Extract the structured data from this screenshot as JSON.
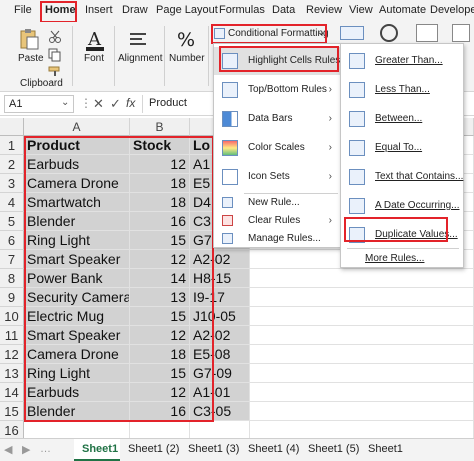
{
  "menu_tabs": [
    "File",
    "Home",
    "Insert",
    "Draw",
    "Page Layout",
    "Formulas",
    "Data",
    "Review",
    "View",
    "Automate",
    "Developer"
  ],
  "ribbon": {
    "paste_label": "Paste",
    "clipboard_label": "Clipboard",
    "font_label": "Font",
    "alignment_label": "Alignment",
    "number_label": "Number",
    "conditional_formatting_label": "Conditional Formatting"
  },
  "formula_bar": {
    "name_box": "A1",
    "fx": "fx",
    "content": "Product"
  },
  "columns": [
    "A",
    "B"
  ],
  "column_c_partial": "",
  "rows": [
    {
      "n": "1",
      "product": "Product",
      "stock": "Stock",
      "loc": "Lo"
    },
    {
      "n": "2",
      "product": "Earbuds",
      "stock": "12",
      "loc": "A1"
    },
    {
      "n": "3",
      "product": "Camera Drone",
      "stock": "18",
      "loc": "E5"
    },
    {
      "n": "4",
      "product": "Smartwatch",
      "stock": "18",
      "loc": "D4"
    },
    {
      "n": "5",
      "product": "Blender",
      "stock": "16",
      "loc": "C3"
    },
    {
      "n": "6",
      "product": "Ring Light",
      "stock": "15",
      "loc": "G7"
    },
    {
      "n": "7",
      "product": "Smart Speaker",
      "stock": "12",
      "loc": "A2-02"
    },
    {
      "n": "8",
      "product": "Power Bank",
      "stock": "14",
      "loc": "H8-15"
    },
    {
      "n": "9",
      "product": "Security Camera",
      "stock": "13",
      "loc": "I9-17"
    },
    {
      "n": "10",
      "product": "Electric Mug",
      "stock": "15",
      "loc": "J10-05"
    },
    {
      "n": "11",
      "product": "Smart Speaker",
      "stock": "12",
      "loc": "A2-02"
    },
    {
      "n": "12",
      "product": "Camera Drone",
      "stock": "18",
      "loc": "E5-08"
    },
    {
      "n": "13",
      "product": "Ring Light",
      "stock": "15",
      "loc": "G7-09"
    },
    {
      "n": "14",
      "product": "Earbuds",
      "stock": "12",
      "loc": "A1-01"
    },
    {
      "n": "15",
      "product": "Blender",
      "stock": "16",
      "loc": "C3-05"
    },
    {
      "n": "16",
      "product": "",
      "stock": "",
      "loc": ""
    }
  ],
  "cf_menu": {
    "items": [
      "Highlight Cells Rules",
      "Top/Bottom Rules",
      "Data Bars",
      "Color Scales",
      "Icon Sets",
      "New Rule...",
      "Clear Rules",
      "Manage Rules..."
    ]
  },
  "highlight_submenu": {
    "items": [
      "Greater Than...",
      "Less Than...",
      "Between...",
      "Equal To...",
      "Text that Contains...",
      "A Date Occurring...",
      "Duplicate Values..."
    ],
    "more_rules": "More Rules..."
  },
  "sheet_tabs": [
    "Sheet1",
    "Sheet1 (2)",
    "Sheet1 (3)",
    "Sheet1 (4)",
    "Sheet1 (5)",
    "Sheet1"
  ],
  "colors": {
    "highlight_red": "#e3232a",
    "selection_gray": "#d2d2d2",
    "excel_green": "#217346"
  }
}
